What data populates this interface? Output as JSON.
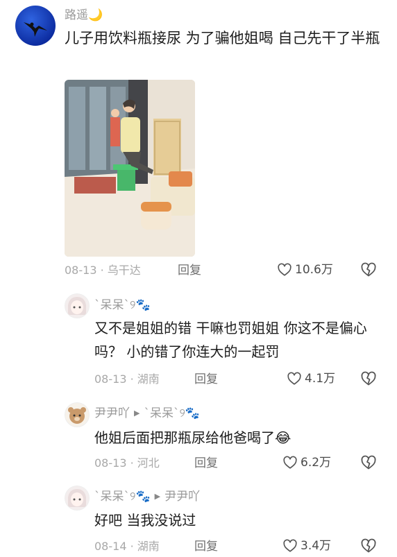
{
  "post": {
    "author": "路遥🌙",
    "text": "儿子用饮料瓶接尿 为了骗他姐喝 自己先干了半瓶",
    "date": "08-13",
    "location": "乌干达",
    "reply_label": "回复",
    "likes": "10.6万"
  },
  "comments": [
    {
      "author": "`呆呆`୨🐾",
      "text": "又不是姐姐的错 干嘛也罚姐姐 你这不是偏心吗？ 小的错了你连大的一起罚",
      "date": "08-13",
      "location": "湖南",
      "reply_label": "回复",
      "likes": "4.1万"
    },
    {
      "author": "尹尹吖",
      "reply_to": "`呆呆`୨🐾",
      "text": "他姐后面把那瓶尿给他爸喝了😂",
      "date": "08-13",
      "location": "河北",
      "reply_label": "回复",
      "likes": "6.2万"
    },
    {
      "author": "`呆呆`୨🐾",
      "reply_to": "尹尹吖",
      "text": "好吧 当我没说过",
      "date": "08-14",
      "location": "湖南",
      "reply_label": "回复",
      "likes": "3.4万"
    }
  ],
  "colors": {
    "meta": "#a8a8a8",
    "name": "#9a9a9a",
    "text": "#1c1c1c"
  },
  "icons": [
    "eagle-avatar-icon",
    "heart-outline-icon",
    "broken-heart-icon",
    "reply-arrow-icon"
  ]
}
